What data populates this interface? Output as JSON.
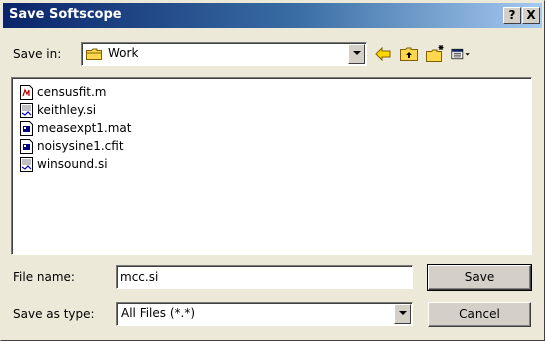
{
  "window": {
    "title": "Save Softscope",
    "help_button": "?",
    "close_button": "X"
  },
  "save_in": {
    "label": "Save in:",
    "value": "Work"
  },
  "toolbar": {
    "icons": [
      "back-arrow-icon",
      "up-one-level-icon",
      "create-new-folder-icon",
      "view-menu-icon"
    ]
  },
  "files": [
    {
      "name": "censusfit.m",
      "icon": "m-file-icon"
    },
    {
      "name": "keithley.si",
      "icon": "si-file-icon"
    },
    {
      "name": "measexpt1.mat",
      "icon": "mat-file-icon"
    },
    {
      "name": "noisysine1.cfit",
      "icon": "cfit-file-icon"
    },
    {
      "name": "winsound.si",
      "icon": "si-file-icon"
    }
  ],
  "file_name": {
    "label": "File name:",
    "value": "mcc.si"
  },
  "save_as_type": {
    "label": "Save as type:",
    "value": "All Files (*.*)"
  },
  "buttons": {
    "save": "Save",
    "cancel": "Cancel"
  },
  "colors": {
    "title_start": "#0a246a",
    "title_end": "#a6caf0",
    "face": "#ece9d8"
  }
}
